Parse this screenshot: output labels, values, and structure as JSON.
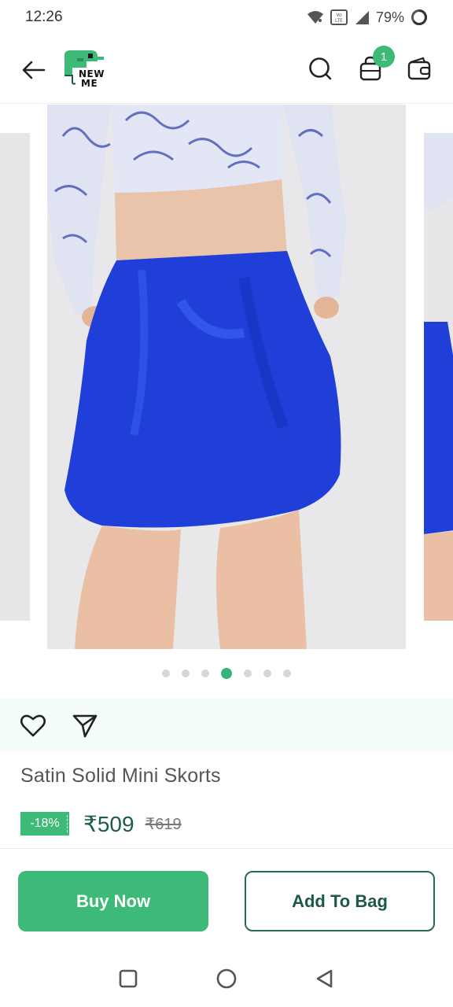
{
  "status_bar": {
    "time": "12:26",
    "battery": "79%",
    "icons": [
      "wifi-icon",
      "volte-icon",
      "signal-icon",
      "battery-icon"
    ]
  },
  "header": {
    "logo_text_line1": "NEW",
    "logo_text_line2": "ME",
    "bag_count": "1",
    "icons": [
      "back-arrow-icon",
      "search-icon",
      "bag-icon",
      "wallet-icon"
    ]
  },
  "carousel": {
    "total_slides": 7,
    "active_index": 3
  },
  "product": {
    "title": "Satin Solid Mini Skorts",
    "discount": "-18%",
    "price": "₹509",
    "mrp": "₹619"
  },
  "actions": {
    "buy_now": "Buy Now",
    "add_to_bag": "Add To Bag"
  },
  "colors": {
    "accent": "#3dba78",
    "dark_green": "#1e5a43",
    "skirt_blue": "#1f3fd8"
  }
}
